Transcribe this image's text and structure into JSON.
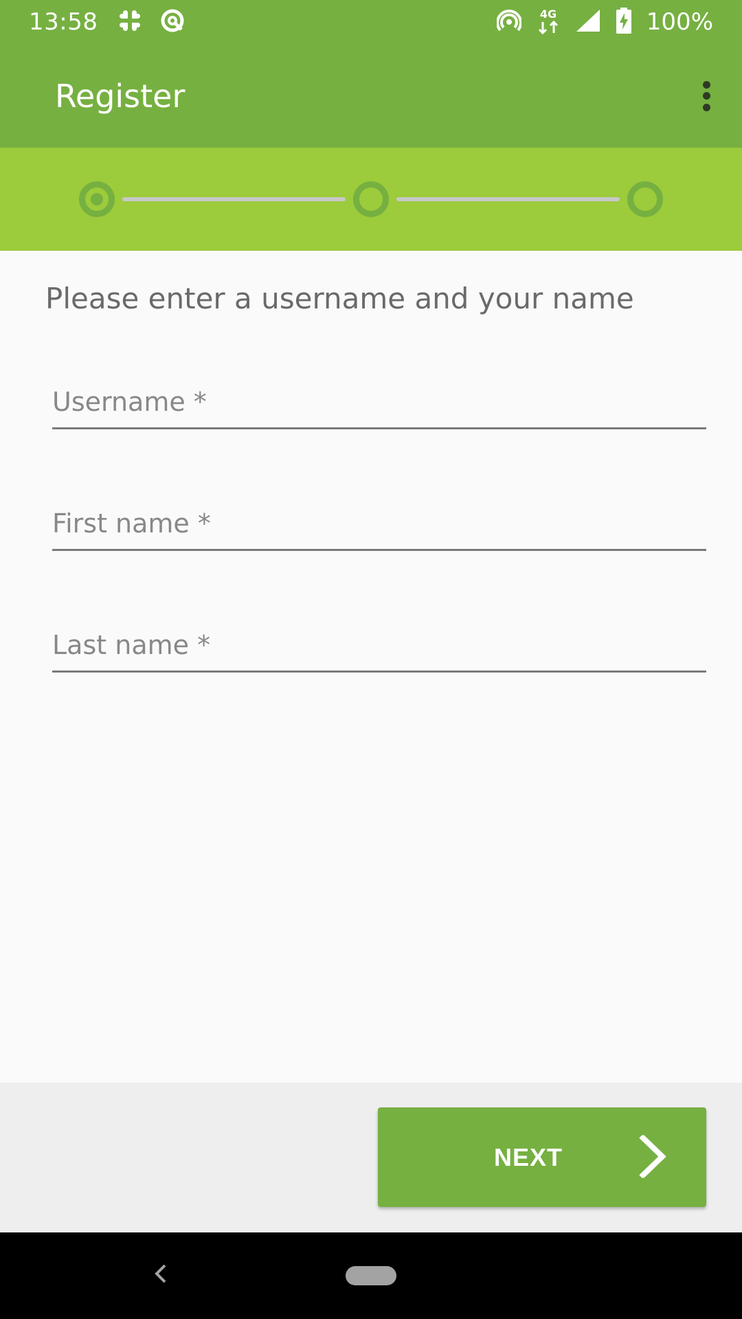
{
  "status_bar": {
    "time": "13:58",
    "network": "4G",
    "battery": "100%",
    "icons": [
      "slack-icon",
      "sync-icon",
      "hotspot-icon",
      "network-4g-icon",
      "signal-icon",
      "battery-charging-icon"
    ]
  },
  "app_bar": {
    "title": "Register",
    "menu_icon": "more-vert-icon"
  },
  "stepper": {
    "current_step": 1,
    "total_steps": 3
  },
  "form": {
    "instruction": "Please enter a username and your name",
    "username": {
      "placeholder": "Username *",
      "value": ""
    },
    "first_name": {
      "placeholder": "First name *",
      "value": ""
    },
    "last_name": {
      "placeholder": "Last name *",
      "value": ""
    }
  },
  "actions": {
    "next_label": "NEXT"
  },
  "colors": {
    "primary": "#76b041",
    "stepper_bg": "#9ccb3b",
    "background": "#fafafa",
    "action_bar_bg": "#eeeeee"
  }
}
